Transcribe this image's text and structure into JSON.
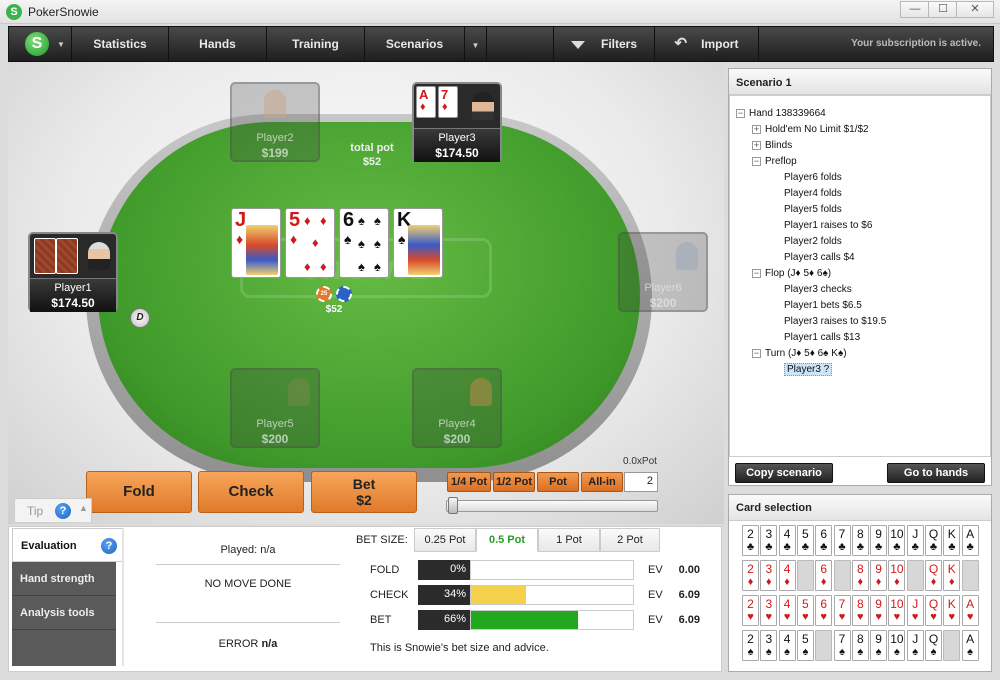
{
  "app": {
    "title": "PokerSnowie",
    "logo_letter": "S"
  },
  "window": {
    "minimize": "—",
    "maximize": "☐",
    "close": "✕"
  },
  "nav": {
    "statistics": "Statistics",
    "hands": "Hands",
    "training": "Training",
    "scenarios": "Scenarios",
    "filters": "Filters",
    "import": "Import",
    "subscription": "Your subscription is active."
  },
  "table": {
    "total_pot_label": "total pot",
    "total_pot_value": "$52",
    "pot_chip_amount": "$52",
    "chip_label": "25",
    "dealer_button": "D",
    "watermark": "SNOWIE",
    "board": [
      {
        "rank": "J",
        "suit": "♦",
        "color": "red"
      },
      {
        "rank": "5",
        "suit": "♦",
        "color": "red"
      },
      {
        "rank": "6",
        "suit": "♠",
        "color": "black"
      },
      {
        "rank": "K",
        "suit": "♠",
        "color": "black"
      }
    ],
    "seats": {
      "player1": {
        "name": "Player1",
        "stack": "$174.50"
      },
      "player2": {
        "name": "Player2",
        "stack": "$199"
      },
      "player3": {
        "name": "Player3",
        "stack": "$174.50",
        "cards": [
          {
            "rank": "A",
            "suit": "♦"
          },
          {
            "rank": "7",
            "suit": "♦"
          }
        ]
      },
      "player4": {
        "name": "Player4",
        "stack": "$200"
      },
      "player5": {
        "name": "Player5",
        "stack": "$200"
      },
      "player6": {
        "name": "Player6",
        "stack": "$200"
      }
    }
  },
  "actions": {
    "fold": "Fold",
    "check": "Check",
    "bet_label": "Bet",
    "bet_amount": "$2",
    "quarter_pot": "1/4 Pot",
    "half_pot": "1/2 Pot",
    "pot": "Pot",
    "all_in": "All-in",
    "bet_multiplier": "0.0xPot",
    "bet_input_value": "2",
    "slider_fraction": 0
  },
  "scenario": {
    "title": "Scenario 1",
    "tree": [
      {
        "level": 0,
        "toggle": "−",
        "text": "Hand 138339664"
      },
      {
        "level": 1,
        "toggle": "+",
        "text": "Hold'em No Limit $1/$2"
      },
      {
        "level": 1,
        "toggle": "+",
        "text": "Blinds"
      },
      {
        "level": 1,
        "toggle": "−",
        "text": "Preflop"
      },
      {
        "level": 2,
        "toggle": "",
        "text": "Player6 folds"
      },
      {
        "level": 2,
        "toggle": "",
        "text": "Player4 folds"
      },
      {
        "level": 2,
        "toggle": "",
        "text": "Player5 folds"
      },
      {
        "level": 2,
        "toggle": "",
        "text": "Player1 raises to $6"
      },
      {
        "level": 2,
        "toggle": "",
        "text": "Player2 folds"
      },
      {
        "level": 2,
        "toggle": "",
        "text": "Player3 calls $4"
      },
      {
        "level": 1,
        "toggle": "−",
        "text": "Flop (J♦ 5♦ 6♠)"
      },
      {
        "level": 2,
        "toggle": "",
        "text": "Player3 checks"
      },
      {
        "level": 2,
        "toggle": "",
        "text": "Player1 bets $6.5"
      },
      {
        "level": 2,
        "toggle": "",
        "text": "Player3 raises to $19.5"
      },
      {
        "level": 2,
        "toggle": "",
        "text": "Player1 calls $13"
      },
      {
        "level": 1,
        "toggle": "−",
        "text": "Turn (J♦ 5♦ 6♠ K♠)"
      },
      {
        "level": 2,
        "toggle": "",
        "text": "Player3 ?",
        "selected": true
      }
    ],
    "copy_button": "Copy scenario",
    "goto_button": "Go to hands"
  },
  "card_selection": {
    "title": "Card selection",
    "ranks": [
      "2",
      "3",
      "4",
      "5",
      "6",
      "7",
      "8",
      "9",
      "10",
      "J",
      "Q",
      "K",
      "A"
    ],
    "rows": [
      {
        "suit": "♣",
        "color": "black",
        "used": []
      },
      {
        "suit": "♦",
        "color": "red",
        "used": [
          "5",
          "7",
          "J",
          "A"
        ]
      },
      {
        "suit": "♥",
        "color": "red",
        "used": []
      },
      {
        "suit": "♠",
        "color": "black",
        "used": [
          "6",
          "K"
        ]
      }
    ]
  },
  "bottom": {
    "tip_label": "Tip",
    "tabs": [
      "Evaluation",
      "Hand strength",
      "Analysis tools"
    ],
    "played": "Played: n/a",
    "no_move": "NO MOVE DONE",
    "error_label": "ERROR",
    "error_value": "n/a",
    "bet_size_label": "BET SIZE:",
    "bet_size_tabs": [
      "0.25 Pot",
      "0.5 Pot",
      "1 Pot",
      "2 Pot"
    ],
    "rows": [
      {
        "label": "FOLD",
        "pct": "0%",
        "fraction": 0.0,
        "ev_label": "EV",
        "ev": "0.00",
        "color": "#ffffff"
      },
      {
        "label": "CHECK",
        "pct": "34%",
        "fraction": 0.34,
        "ev_label": "EV",
        "ev": "6.09",
        "color": "#f5d04a"
      },
      {
        "label": "BET",
        "pct": "66%",
        "fraction": 0.66,
        "ev_label": "EV",
        "ev": "6.09",
        "color": "#22a81e"
      }
    ],
    "advice": "This is Snowie's bet size and advice."
  }
}
